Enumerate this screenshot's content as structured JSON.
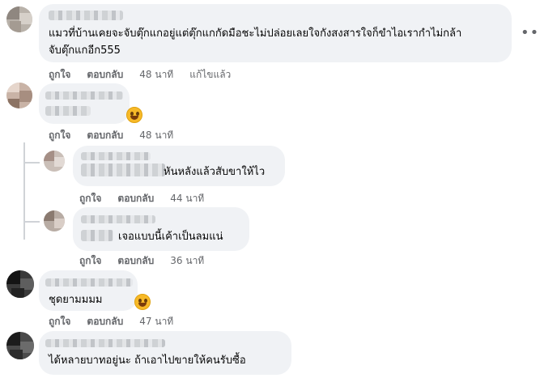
{
  "comments": [
    {
      "text_line1": "แมวที่บ้านเคยจะจับตุ๊กแกอยู่แต่ตุ๊กแกกัดมือชะไม่ปล่อยเลยใจกังสงสารใจก็ขำไอเรากำไม่กล้า",
      "text_line2": "จับตุ๊กแกอีก555",
      "like": "ถูกใจ",
      "reply": "ตอบกลับ",
      "time": "48 นาที",
      "edited": "แก้ไขแล้ว",
      "menu_icon": "more-horizontal-icon"
    },
    {
      "like": "ถูกใจ",
      "reply": "ตอบกลับ",
      "time": "48 นาที",
      "reaction_icon": "laughing-emoji-icon"
    },
    {
      "text": "หันหลังแล้วสับขาให้ไว",
      "like": "ถูกใจ",
      "reply": "ตอบกลับ",
      "time": "44 นาที"
    },
    {
      "text": "เจอแบบนี้เค้าเป็นลมแน่",
      "like": "ถูกใจ",
      "reply": "ตอบกลับ",
      "time": "36 นาที"
    },
    {
      "text": "ชุดยามมมม",
      "like": "ถูกใจ",
      "reply": "ตอบกลับ",
      "time": "47 นาที",
      "reaction_icon": "laughing-emoji-icon"
    },
    {
      "text": "ได้หลายบาทอยู่นะ ถ้าเอาไปขายให้คนรับซื้อ"
    }
  ],
  "colors": {
    "bubble": "#f0f2f5",
    "meta_text": "#65676b",
    "comment_text": "#050505",
    "emoji": "#f7b928"
  }
}
